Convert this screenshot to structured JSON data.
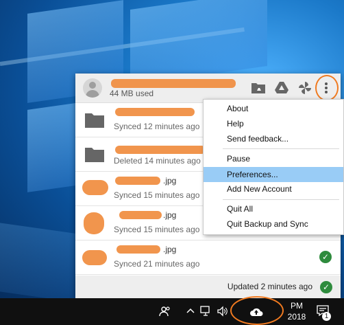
{
  "popup": {
    "storage_usage": "44 MB used",
    "header_icons": [
      "folder-drive-icon",
      "google-drive-icon",
      "google-photos-icon",
      "more-vert-icon"
    ],
    "items": [
      {
        "type": "folder",
        "ext": "",
        "status": "Synced 12 minutes ago",
        "synced": false
      },
      {
        "type": "folder",
        "ext": "",
        "status": "Deleted 14 minutes ago",
        "synced": false
      },
      {
        "type": "image",
        "ext": ".jpg",
        "status": "Synced 15 minutes ago",
        "synced": false
      },
      {
        "type": "image",
        "ext": ".jpg",
        "status": "Synced 15 minutes ago",
        "synced": false
      },
      {
        "type": "image",
        "ext": ".jpg",
        "status": "Synced 21 minutes ago",
        "synced": true
      }
    ],
    "footer_status": "Updated 2 minutes ago"
  },
  "menu": {
    "items": [
      "About",
      "Help",
      "Send feedback...",
      "Pause",
      "Preferences...",
      "Add New Account",
      "Quit All",
      "Quit Backup and Sync"
    ],
    "highlighted": "Preferences..."
  },
  "taskbar": {
    "time": "PM",
    "date": "2018",
    "notification_count": "1",
    "icons": [
      "people-icon",
      "chevron-up-icon",
      "network-icon",
      "volume-icon",
      "backup-sync-cloud-icon",
      "action-center-icon"
    ]
  },
  "colors": {
    "highlight": "#99ccf6",
    "annotation": "#f07a20",
    "check": "#2e8b3d"
  }
}
